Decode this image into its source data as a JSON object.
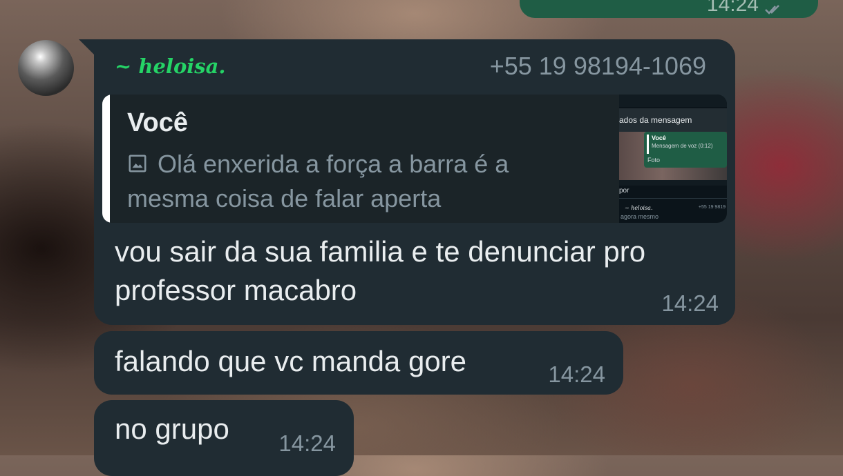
{
  "outgoing_message": {
    "time": "14:24"
  },
  "sender": {
    "name": "~ heloisa.",
    "phone": "+55 19 98194-1069"
  },
  "quoted_message": {
    "author": "Você",
    "text": "Olá enxerida a força a barra é a mesma coisa de falar aperta",
    "icon": "photo-icon",
    "thumbnail": {
      "title": "ados da mensagem",
      "card_author": "Você",
      "card_voice": "Mensagem de voz (0:12)",
      "card_photo": "Foto",
      "label": "por",
      "contact_name": "~ heloisa.",
      "contact_phone": "+55 19 9819",
      "status": "agora mesmo"
    }
  },
  "messages": [
    {
      "text": "vou sair da sua familia e te denunciar pro professor macabro",
      "time": "14:24"
    },
    {
      "text": "falando que vc manda gore",
      "time": "14:24"
    },
    {
      "text": "no grupo",
      "time": "14:24"
    }
  ],
  "colors": {
    "incoming_bubble": "#202c33",
    "outgoing_bubble": "#1f5d45",
    "sender_name": "#25d366",
    "secondary_text": "#8696a0"
  }
}
